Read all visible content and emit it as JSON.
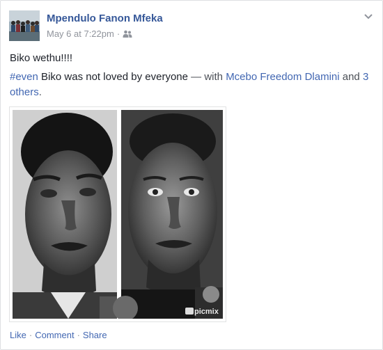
{
  "post": {
    "author": "Mpendulo Fanon Mfeka",
    "timestamp": "May 6 at 7:22pm",
    "meta_separator": "·",
    "audience_icon": "friends-icon",
    "text_line1": "Biko wethu!!!!",
    "hashtag": "#even",
    "text_main": " Biko was not loved by everyone ",
    "with_prefix": "— with ",
    "tagged_person": "Mcebo Freedom Dlamini",
    "and_text": " and ",
    "others_link": "3 others",
    "period": ".",
    "photo_watermark": "picmix"
  },
  "actions": {
    "like": "Like",
    "comment": "Comment",
    "share": "Share",
    "separator": "·"
  },
  "colors": {
    "link": "#4267b2",
    "author": "#365899",
    "muted": "#90949c"
  }
}
